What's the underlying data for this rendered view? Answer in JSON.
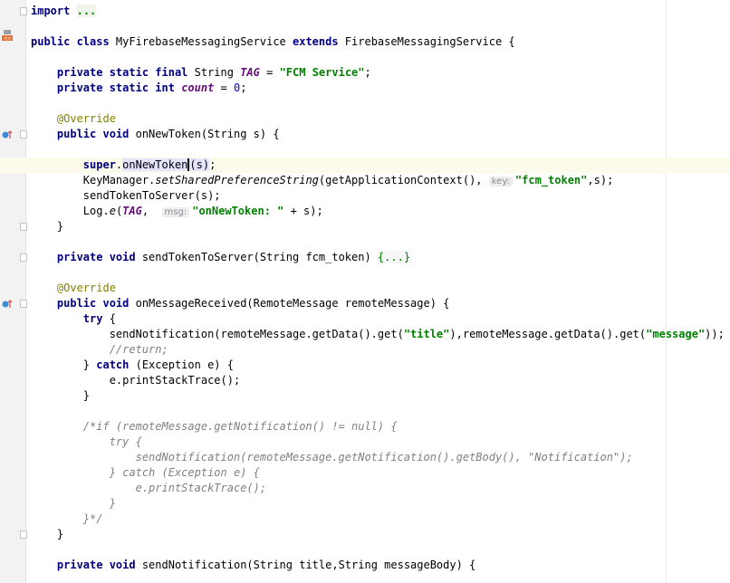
{
  "editor": {
    "language": "java",
    "lines": [
      {
        "tokens": [
          {
            "t": "import",
            "c": "kw"
          },
          {
            "t": " "
          },
          {
            "t": "...",
            "c": "import-bg str"
          }
        ]
      },
      {
        "tokens": []
      },
      {
        "tokens": [
          {
            "t": "public class ",
            "c": "kw"
          },
          {
            "t": "MyFirebaseMessagingService "
          },
          {
            "t": "extends ",
            "c": "kw"
          },
          {
            "t": "FirebaseMessagingService {"
          }
        ]
      },
      {
        "tokens": []
      },
      {
        "tokens": [
          {
            "t": "    "
          },
          {
            "t": "private static final ",
            "c": "kw"
          },
          {
            "t": "String "
          },
          {
            "t": "TAG",
            "c": "const"
          },
          {
            "t": " = "
          },
          {
            "t": "\"FCM Service\"",
            "c": "str"
          },
          {
            "t": ";"
          }
        ]
      },
      {
        "tokens": [
          {
            "t": "    "
          },
          {
            "t": "private static int ",
            "c": "kw"
          },
          {
            "t": "count",
            "c": "const"
          },
          {
            "t": " = "
          },
          {
            "t": "0",
            "c": "num"
          },
          {
            "t": ";"
          }
        ]
      },
      {
        "tokens": []
      },
      {
        "tokens": [
          {
            "t": "    "
          },
          {
            "t": "@Override",
            "c": "ann"
          }
        ]
      },
      {
        "tokens": [
          {
            "t": "    "
          },
          {
            "t": "public void ",
            "c": "kw"
          },
          {
            "t": "onNewToken(String s) {"
          }
        ]
      },
      {
        "tokens": []
      },
      {
        "current": true,
        "tokens": [
          {
            "t": "        "
          },
          {
            "t": "super",
            "c": "kw"
          },
          {
            "t": "."
          },
          {
            "t": "onNewToken",
            "c": "hl"
          },
          {
            "t": "",
            "c": "caret"
          },
          {
            "t": "(s)",
            "c": "hl"
          },
          {
            "t": ";"
          }
        ]
      },
      {
        "tokens": [
          {
            "t": "        KeyManager."
          },
          {
            "t": "setSharedPreferenceString",
            "c": "ital"
          },
          {
            "t": "(getApplicationContext(), "
          },
          {
            "t": "key:",
            "c": "hint"
          },
          {
            "t": "\"fcm_token\"",
            "c": "str"
          },
          {
            "t": ",s);"
          }
        ]
      },
      {
        "tokens": [
          {
            "t": "        sendTokenToServer(s);"
          }
        ]
      },
      {
        "tokens": [
          {
            "t": "        Log."
          },
          {
            "t": "e",
            "c": "ital"
          },
          {
            "t": "("
          },
          {
            "t": "TAG",
            "c": "const"
          },
          {
            "t": ",  "
          },
          {
            "t": "msg:",
            "c": "hint"
          },
          {
            "t": "\"onNewToken: \"",
            "c": "str"
          },
          {
            "t": " + s);"
          }
        ]
      },
      {
        "tokens": [
          {
            "t": "    }"
          }
        ]
      },
      {
        "tokens": []
      },
      {
        "tokens": [
          {
            "t": "    "
          },
          {
            "t": "private void ",
            "c": "kw"
          },
          {
            "t": "sendTokenToServer(String fcm_token) "
          },
          {
            "t": "{...}",
            "c": "fold-text"
          }
        ]
      },
      {
        "tokens": []
      },
      {
        "tokens": [
          {
            "t": "    "
          },
          {
            "t": "@Override",
            "c": "ann"
          }
        ]
      },
      {
        "tokens": [
          {
            "t": "    "
          },
          {
            "t": "public void ",
            "c": "kw"
          },
          {
            "t": "onMessageReceived(RemoteMessage remoteMessage) {"
          }
        ]
      },
      {
        "tokens": [
          {
            "t": "        "
          },
          {
            "t": "try ",
            "c": "kw"
          },
          {
            "t": "{"
          }
        ]
      },
      {
        "tokens": [
          {
            "t": "            sendNotification(remoteMessage.getData().get("
          },
          {
            "t": "\"title\"",
            "c": "str"
          },
          {
            "t": "),remoteMessage.getData().get("
          },
          {
            "t": "\"message\"",
            "c": "str"
          },
          {
            "t": "));"
          }
        ]
      },
      {
        "tokens": [
          {
            "t": "            "
          },
          {
            "t": "//return;",
            "c": "cmt"
          }
        ]
      },
      {
        "tokens": [
          {
            "t": "        } "
          },
          {
            "t": "catch ",
            "c": "kw"
          },
          {
            "t": "(Exception e) {"
          }
        ]
      },
      {
        "tokens": [
          {
            "t": "            e.printStackTrace();"
          }
        ]
      },
      {
        "tokens": [
          {
            "t": "        }"
          }
        ]
      },
      {
        "tokens": []
      },
      {
        "tokens": [
          {
            "t": "        "
          },
          {
            "t": "/*if (remoteMessage.getNotification() != null) {",
            "c": "cmt"
          }
        ]
      },
      {
        "tokens": [
          {
            "t": "            "
          },
          {
            "t": "try {",
            "c": "cmt"
          }
        ]
      },
      {
        "tokens": [
          {
            "t": "                "
          },
          {
            "t": "sendNotification(remoteMessage.getNotification().getBody(), \"Notification\");",
            "c": "cmt"
          }
        ]
      },
      {
        "tokens": [
          {
            "t": "            "
          },
          {
            "t": "} catch (Exception e) {",
            "c": "cmt"
          }
        ]
      },
      {
        "tokens": [
          {
            "t": "                "
          },
          {
            "t": "e.printStackTrace();",
            "c": "cmt"
          }
        ]
      },
      {
        "tokens": [
          {
            "t": "            "
          },
          {
            "t": "}",
            "c": "cmt"
          }
        ]
      },
      {
        "tokens": [
          {
            "t": "        "
          },
          {
            "t": "}*/",
            "c": "cmt"
          }
        ]
      },
      {
        "tokens": [
          {
            "t": "    }"
          }
        ]
      },
      {
        "tokens": []
      },
      {
        "tokens": [
          {
            "t": "    "
          },
          {
            "t": "private void ",
            "c": "kw"
          },
          {
            "t": "sendNotification(String title,String messageBody) {"
          }
        ]
      }
    ]
  },
  "gutter": {
    "folds": [
      0,
      8,
      14,
      16,
      19,
      34
    ],
    "override_icons": [
      8,
      19
    ],
    "class_icon_line": 2
  }
}
